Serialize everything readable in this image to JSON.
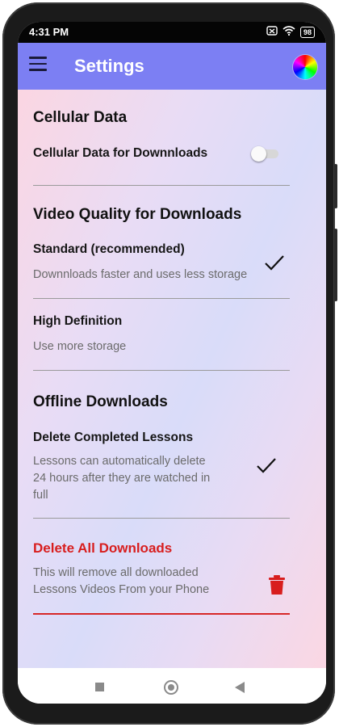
{
  "status_bar": {
    "time": "4:31 PM",
    "battery": "98",
    "icons": [
      "sim-off-icon",
      "wifi-icon",
      "battery-icon"
    ]
  },
  "app_bar": {
    "title": "Settings",
    "menu_icon": "hamburger-menu-icon",
    "theme_icon": "color-wheel-icon",
    "color": "#7c7ff3"
  },
  "cellular": {
    "section_title": "Cellular Data",
    "option_label": "Cellular Data for Downnloads",
    "toggle_on": false
  },
  "video_quality": {
    "section_title": "Video Quality for Downloads",
    "options": [
      {
        "label": "Standard (recommended)",
        "description": "Downnloads faster and uses less storage",
        "selected": true
      },
      {
        "label": "High Definition",
        "description": "Use more storage",
        "selected": false
      }
    ]
  },
  "offline": {
    "section_title": "Offline Downloads",
    "delete_completed": {
      "label": "Delete Completed Lessons",
      "description_lines": [
        "Lessons can automatically delete",
        "24 hours after they are watched in",
        "full"
      ],
      "checked": true
    },
    "delete_all": {
      "label": "Delete All Downloads",
      "description_lines": [
        "This will remove all downloaded",
        "Lessons Videos From your Phone"
      ],
      "color": "#d81e1e",
      "icon": "trash-icon"
    }
  },
  "nav_bar": {
    "icons": [
      "recent-apps-icon",
      "home-icon",
      "back-icon"
    ]
  }
}
